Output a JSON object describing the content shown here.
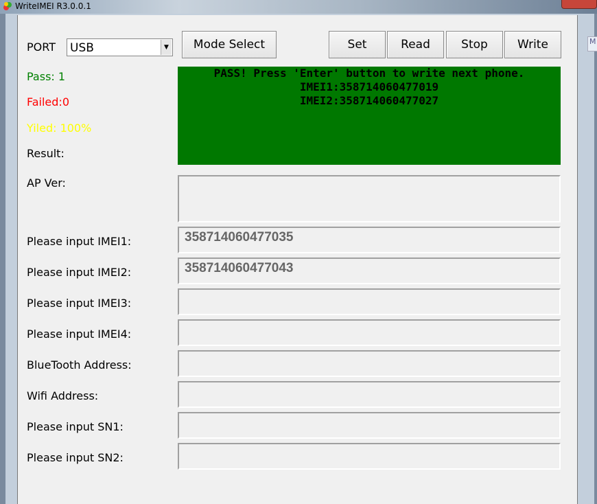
{
  "window": {
    "title": "WriteIMEI R3.0.0.1",
    "close_label": "x",
    "side_tab": "M"
  },
  "toolbar": {
    "port_label": "PORT",
    "port_value": "USB",
    "mode_select": "Mode Select",
    "set": "Set",
    "read": "Read",
    "stop": "Stop",
    "write": "Write"
  },
  "stats": {
    "pass": "Pass:  1",
    "failed": "Failed:0",
    "yield": "Yiled: 100%",
    "result": "Result:"
  },
  "colors": {
    "pass": "#008000",
    "failed": "#ff0000",
    "yield": "#ffff00",
    "status_bg": "#007800"
  },
  "status": {
    "line1": "PASS! Press 'Enter'  button to write next phone.",
    "line2": "IMEI1:358714060477019",
    "line3": "IMEI2:358714060477027"
  },
  "ap_ver": {
    "label": "AP Ver:",
    "value": ""
  },
  "fields": [
    {
      "label": "Please input IMEI1:",
      "value": "358714060477035"
    },
    {
      "label": "Please input IMEI2:",
      "value": "358714060477043"
    },
    {
      "label": "Please input IMEI3:",
      "value": ""
    },
    {
      "label": "Please input IMEI4:",
      "value": ""
    },
    {
      "label": "BlueTooth Address:",
      "value": ""
    },
    {
      "label": "Wifi Address:",
      "value": ""
    },
    {
      "label": "Please input SN1:",
      "value": ""
    },
    {
      "label": "Please input SN2:",
      "value": ""
    }
  ]
}
